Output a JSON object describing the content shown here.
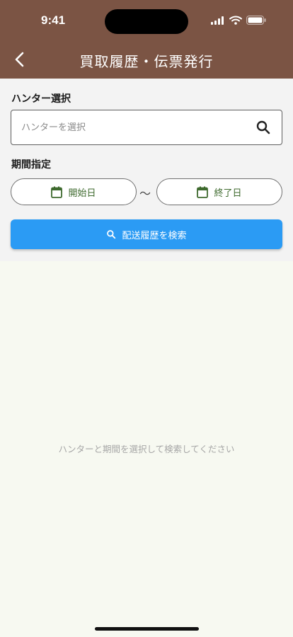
{
  "status_bar": {
    "time": "9:41"
  },
  "header": {
    "title": "買取履歴・伝票発行",
    "background": "#7b5444"
  },
  "hunter": {
    "label": "ハンター選択",
    "placeholder": "ハンターを選択",
    "value": ""
  },
  "period": {
    "label": "期間指定",
    "start_label": "開始日",
    "separator": "〜",
    "end_label": "終了日"
  },
  "search_button": {
    "label": "配送履歴を検索",
    "color": "#2b9bf4"
  },
  "empty_state": {
    "message": "ハンターと期間を選択して検索してください"
  },
  "icons": {
    "back": "chevron-left-icon",
    "search": "search-icon",
    "calendar": "calendar-icon"
  }
}
